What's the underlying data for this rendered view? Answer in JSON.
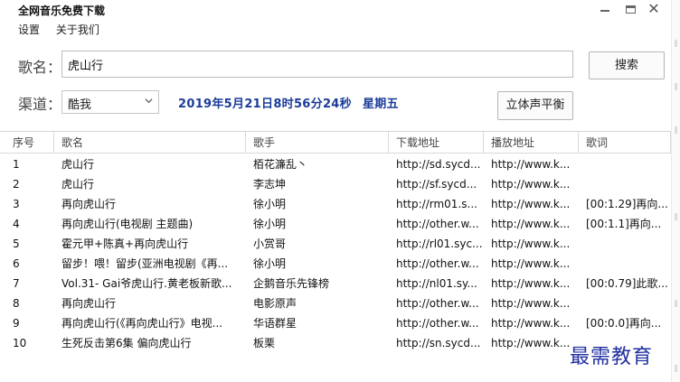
{
  "window": {
    "title": "全网音乐免费下载"
  },
  "menu": [
    "设置",
    "关于我们"
  ],
  "search": {
    "label": "歌名：",
    "value": "虎山行",
    "button": "搜索"
  },
  "channel": {
    "label": "渠道：",
    "selected": "酷我"
  },
  "datetime": {
    "date": "2019年5月21日8时56分24秒",
    "weekday": "星期五"
  },
  "stereo_button": "立体声平衡",
  "table": {
    "headers": [
      "序号",
      "歌名",
      "歌手",
      "下载地址",
      "播放地址",
      "歌词"
    ],
    "rows": [
      [
        "1",
        "虎山行",
        "栢花濂乱丶",
        "http://sd.sycd...",
        "http://www.k...",
        ""
      ],
      [
        "2",
        "虎山行",
        "李志坤",
        "http://sf.sycd...",
        "http://www.k...",
        ""
      ],
      [
        "3",
        "再向虎山行",
        "徐小明",
        "http://rm01.s...",
        "http://www.k...",
        "[00:1.29]再向..."
      ],
      [
        "4",
        "再向虎山行(电视剧 主题曲)",
        "徐小明",
        "http://other.w...",
        "http://www.k...",
        "[00:1.1]再向..."
      ],
      [
        "5",
        "霍元甲+陈真+再向虎山行",
        "小赏哥",
        "http://rl01.syc...",
        "http://www.k...",
        ""
      ],
      [
        "6",
        "留步！喂！留步(亚洲电视剧《再...",
        "徐小明",
        "http://other.w...",
        "http://www.k...",
        ""
      ],
      [
        "7",
        "Vol.31- Gai爷虎山行.黄老板新歌...",
        "企鹅音乐先锋榜",
        "http://nl01.sy...",
        "http://www.k...",
        "[00:0.79]此歌..."
      ],
      [
        "8",
        "再向虎山行",
        "电影原声",
        "http://other.w...",
        "http://www.k...",
        ""
      ],
      [
        "9",
        "再向虎山行(《再向虎山行》电视...",
        "华语群星",
        "http://other.w...",
        "http://www.k...",
        "[00:0.0]再向..."
      ],
      [
        "10",
        "生死反击第6集 偏向虎山行",
        "板栗",
        "http://sn.sycd...",
        "http://www.k...",
        ""
      ]
    ]
  },
  "watermark": "最需教育"
}
